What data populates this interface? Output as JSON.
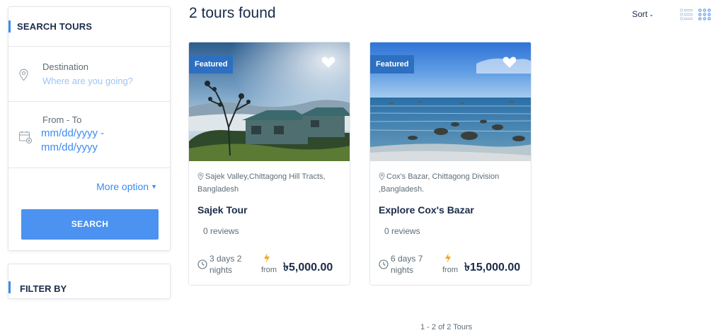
{
  "sidebar": {
    "search_title": "SEARCH TOURS",
    "destination_label": "Destination",
    "destination_placeholder": "Where are you going?",
    "dates_label": "From - To",
    "dates_placeholder": "mm/dd/yyyy - mm/dd/yyyy",
    "more_option": "More option",
    "search_button": "SEARCH",
    "filter_title": "FILTER BY"
  },
  "header": {
    "results_count": "2 tours found",
    "sort_label": "Sort"
  },
  "tours": [
    {
      "badge": "Featured",
      "location": "Sajek Valley,Chittagong Hill Tracts, Bangladesh",
      "name": "Sajek Tour",
      "reviews": "0 reviews",
      "duration": "3 days 2 nights",
      "from_label": "from",
      "price": "৳5,000.00"
    },
    {
      "badge": "Featured",
      "location": "Cox's Bazar, Chittagong Division ,Bangladesh.",
      "name": "Explore Cox's Bazar",
      "reviews": "0 reviews",
      "duration": "6 days 7 nights",
      "from_label": "from",
      "price": "৳15,000.00"
    }
  ],
  "pagination": {
    "summary": "1 - 2 of 2 Tours"
  },
  "colors": {
    "accent": "#3b8cf0",
    "button": "#4c92f1",
    "badge": "#2d6fc0",
    "text_dark": "#1a2b49",
    "text_muted": "#5e6d77",
    "bolt": "#f5a623"
  },
  "icons": {
    "destination": "map-pin-icon",
    "dates": "calendar-icon",
    "favorite": "heart-icon",
    "duration": "clock-icon",
    "from": "lightning-icon",
    "list_view": "list-view-icon",
    "grid_view": "grid-view-icon"
  }
}
